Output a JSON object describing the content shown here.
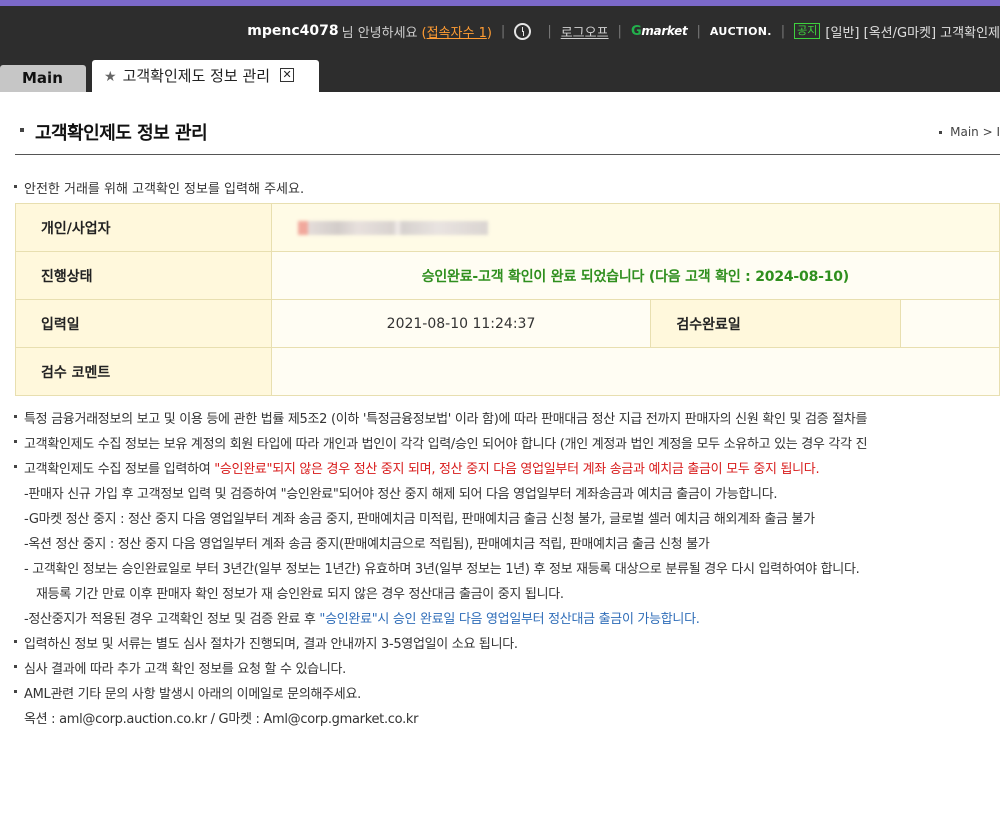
{
  "header": {
    "user_id": "mpenc4078",
    "greeting": "님 안녕하세요",
    "connect_label": "접속자수 1",
    "paren_open": "(",
    "paren_close": ")",
    "logout": "로그오프",
    "gmarket_label": "market",
    "auction_label": "AUCTION.",
    "notice_badge": "공지",
    "notice_text": "[일반] [옥션/G마켓] 고객확인제"
  },
  "tabs": {
    "main": "Main",
    "active": "고객확인제도 정보 관리"
  },
  "page": {
    "title": "고객확인제도 정보 관리",
    "breadcrumb": "Main > I",
    "intro": "안전한 거래를 위해 고객확인 정보를 입력해 주세요."
  },
  "info_table": {
    "row1_label": "개인/사업자",
    "row2_label": "진행상태",
    "status_text": "승인완료-고객 확인이 완료 되었습니다 (다음 고객 확인 : 2024-08-10)",
    "row3_label": "입력일",
    "input_date": "2021-08-10 11:24:37",
    "review_done_label": "검수완료일",
    "row4_label": "검수 코멘트"
  },
  "notes": {
    "n1": "특정 금융거래정보의 보고 및 이용 등에 관한 법률 제5조2 (이하 '특정금융정보법' 이라 함)에 따라 판매대금 정산 지급 전까지 판매자의 신원 확인 및 검증 절차를",
    "n2": "고객확인제도 수집 정보는 보유 계정의 회원 타입에 따라 개인과 법인이 각각 입력/승인 되어야 합니다 (개인 계정과 법인 계정을 모두 소유하고 있는 경우 각각 진",
    "n3a": "고객확인제도 수집 정보를 입력하여 ",
    "n3b": "\"승인완료\"되지 않은 경우 정산 중지 되며, 정산 중지 다음 영업일부터 계좌 송금과 예치금 출금이 모두 중지 됩니다.",
    "s1": "-판매자 신규 가입 후 고객정보 입력 및 검증하여 \"승인완료\"되어야 정산 중지 해제 되어 다음 영업일부터 계좌송금과 예치금 출금이 가능합니다.",
    "s2": "-G마켓 정산 중지 : 정산 중지 다음 영업일부터 계좌 송금 중지, 판매예치금 미적립, 판매예치금 출금 신청 불가, 글로벌 셀러 예치금 해외계좌 출금 불가",
    "s3": "-옥션 정산 중지 : 정산 중지 다음 영업일부터 계좌 송금 중지(판매예치금으로 적립됨), 판매예치금 적립, 판매예치금 출금 신청 불가",
    "s4": "- 고객확인 정보는 승인완료일로 부터 3년간(일부 정보는 1년간) 유효하며 3년(일부 정보는 1년) 후 정보 재등록 대상으로 분류될 경우 다시 입력하여야 합니다.",
    "s5": "재등록 기간 만료 이후 판매자 확인 정보가 재 승인완료 되지 않은 경우 정산대금 출금이 중지 됩니다.",
    "s6a": "-정산중지가 적용된 경우 고객확인 정보 및 검증 완료 후 ",
    "s6b": "\"승인완료\"시 승인 완료일 다음 영업일부터 정산대금 출금이 가능합니다.",
    "n4": "입력하신 정보 및 서류는 별도 심사 절차가 진행되며, 결과 안내까지 3-5영업일이 소요 됩니다.",
    "n5": "심사 결과에 따라 추가 고객 확인 정보를 요청 할 수 있습니다.",
    "n6": "AML관련 기타 문의 사항 발생시 아래의 이메일로 문의해주세요.",
    "n7": "옥션 : aml@corp.auction.co.kr / G마켓 : Aml@corp.gmarket.co.kr"
  },
  "colors": {
    "accent_top": "#7b69c9",
    "header_bg": "#2d2d2d",
    "status_green": "#2f8f1e",
    "warning_red": "#d81b1b",
    "link_blue": "#2f6db8"
  }
}
